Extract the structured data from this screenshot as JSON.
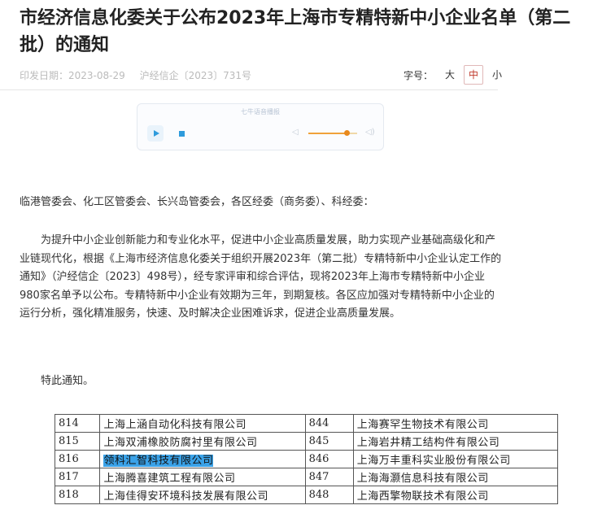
{
  "article": {
    "title": "市经济信息化委关于公布2023年上海市专精特新中小企业名单（第二批）的通知",
    "issue_date": "印发日期：2023-08-29",
    "doc_number": "沪经信企〔2023〕731号"
  },
  "font_size": {
    "label": "字号：",
    "options": [
      "大",
      "中",
      "小"
    ],
    "selected": "中"
  },
  "player": {
    "label": "七牛语音播报",
    "volume_percent": 75,
    "icons": {
      "play": "play-icon",
      "stop": "stop-icon",
      "vol_down": "volume-down-icon",
      "vol_up": "volume-up-icon"
    }
  },
  "content": {
    "addressee": "临港管委会、化工区管委会、长兴岛管委会，各区经委（商务委）、科经委：",
    "paragraph": "为提升中小企业创新能力和专业化水平，促进中小企业高质量发展，助力实现产业基础高级化和产业链现代化，根据《上海市经济信息化委关于组织开展2023年（第二批）专精特新中小企业认定工作的通知》（沪经信企〔2023〕498号），经专家评审和综合评估，现将2023年上海市专精特新中小企业980家名单予以公布。专精特新中小企业有效期为三年，到期复核。各区应加强对专精特新中小企业的运行分析，强化精准服务，快速、及时解决企业困难诉求，促进企业高质量发展。",
    "closing": "特此通知。"
  },
  "table": {
    "rows": [
      {
        "left_num": "814",
        "left_name": "上海上涵自动化科技有限公司",
        "right_num": "844",
        "right_name": "上海赛罕生物技术有限公司"
      },
      {
        "left_num": "815",
        "left_name": "上海双浦橡胶防腐衬里有限公司",
        "right_num": "845",
        "right_name": "上海岩井精工结构件有限公司"
      },
      {
        "left_num": "816",
        "left_name": "领科汇智科技有限公司",
        "right_num": "846",
        "right_name": "上海万丰重科实业股份有限公司"
      },
      {
        "left_num": "817",
        "left_name": "上海腾喜建筑工程有限公司",
        "right_num": "847",
        "right_name": "上海海灏信息科技有限公司"
      },
      {
        "left_num": "818",
        "left_name": "上海佳得安环境科技发展有限公司",
        "right_num": "848",
        "right_name": "上海西擎物联技术有限公司"
      }
    ]
  },
  "colors": {
    "highlight": "#3aa2e8",
    "accent": "#c0392b",
    "volume": "#e8891c",
    "play": "#2e9bdc"
  }
}
